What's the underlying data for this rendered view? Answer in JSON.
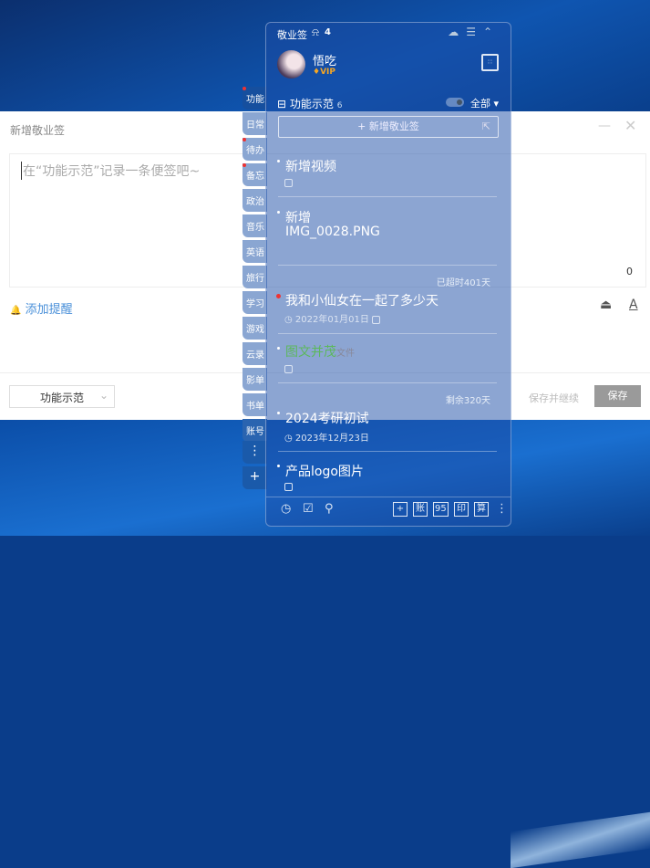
{
  "dialog": {
    "title": "新增敬业签",
    "placeholder": "在“功能示范”记录一条便签吧~",
    "char_count": "0",
    "add_reminder": "添加提醒",
    "category": "功能示范",
    "save_continue": "保存并继续",
    "save": "保存",
    "minimize": "—",
    "close": "✕",
    "bell_icon": "🔔",
    "chevron": "⌄",
    "image_icon": "⏏",
    "font_icon": "A"
  },
  "tabs": [
    "功能",
    "日常",
    "待办",
    "备忘",
    "政治",
    "音乐",
    "英语",
    "旅行",
    "学习",
    "游戏",
    "云录",
    "影单",
    "书单",
    "账号"
  ],
  "tab_more": "⋮",
  "tab_add": "+",
  "panel": {
    "title": "敬业签",
    "notif_icon": "⍾",
    "notif_count": "4",
    "top_icons": "☁☰⌃",
    "user": {
      "name": "悟吃",
      "badge": "♦VIP"
    },
    "calendar": "∷",
    "category": {
      "name": "功能示范",
      "count": "6",
      "filter": "全部 ▾",
      "icon": "⊟"
    },
    "new_button": "+ 新增敬业签",
    "new_ext": "⇱",
    "items": [
      {
        "title": "新增视频"
      },
      {
        "title_line1": "新增",
        "title_line2": "IMG_0028.PNG"
      },
      {
        "note": "已超时401天",
        "title": "我和小仙女在一起了多少天",
        "date": "2022年01月01日"
      },
      {
        "title_green": "图文并茂",
        "title_rest": "文件"
      },
      {
        "note": "剩余320天",
        "title": "2024考研初试",
        "date": "2023年12月23日"
      },
      {
        "title": "产品logo图片"
      }
    ],
    "footer": {
      "clock": "◷",
      "todo": "☑",
      "search": "⚲",
      "add": "+",
      "account": "账",
      "num": "95",
      "print": "印",
      "calc": "算",
      "more": "⋮"
    }
  }
}
